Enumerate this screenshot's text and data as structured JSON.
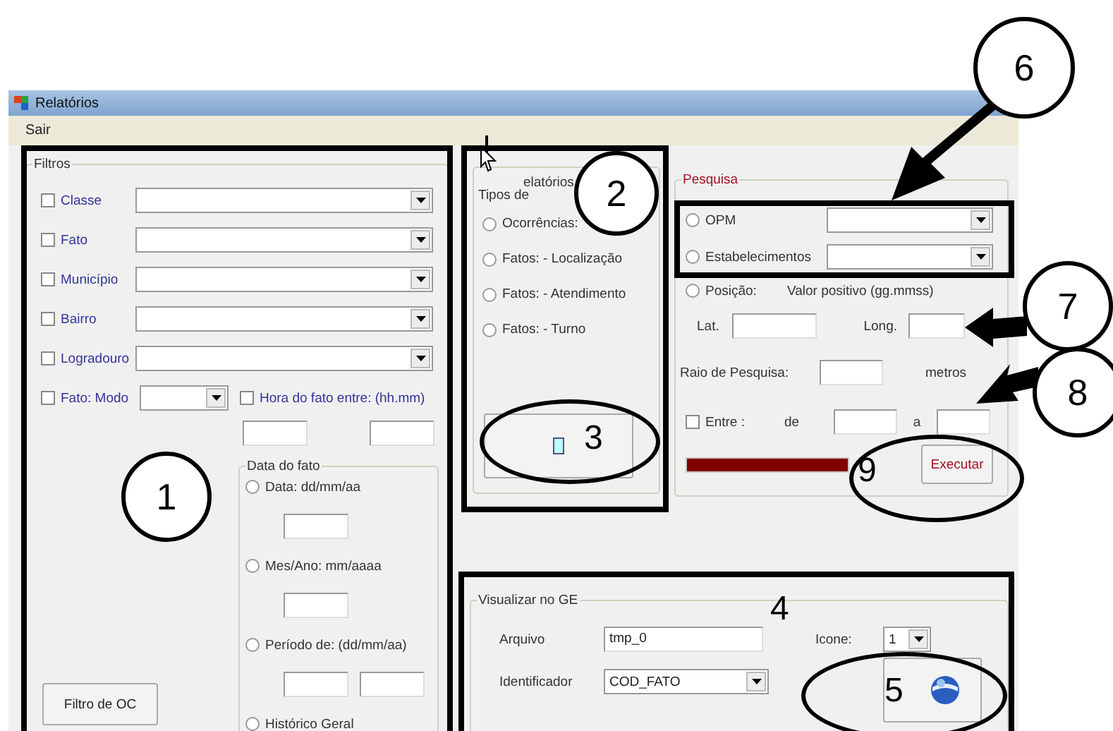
{
  "window": {
    "title": "Relatórios"
  },
  "menu": [
    "Sair"
  ],
  "filters": {
    "title": "Filtros",
    "rows": [
      {
        "label": "Classe",
        "checked": false
      },
      {
        "label": "Fato",
        "checked": false
      },
      {
        "label": "Município",
        "checked": false
      },
      {
        "label": "Bairro",
        "checked": false
      },
      {
        "label": "Logradouro",
        "checked": false
      }
    ],
    "mode": {
      "label": "Fato: Modo",
      "checked": false
    },
    "hour": {
      "label": "Hora do fato entre: (hh.mm)",
      "checked": false
    },
    "date_group": {
      "title": "Data do fato",
      "options": [
        {
          "label": "Data: dd/mm/aa",
          "selected": false,
          "kind": "single"
        },
        {
          "label": "Mes/Ano: mm/aaaa",
          "selected": false,
          "kind": "single"
        },
        {
          "label": "Período de: (dd/mm/aa)",
          "selected": false,
          "kind": "range"
        },
        {
          "label": "Histórico Geral",
          "selected": false,
          "kind": "plain"
        }
      ]
    },
    "button": "Filtro de OC"
  },
  "report_types": {
    "title": "Tipos de",
    "title_covered": "elatórios",
    "options": [
      {
        "label": "Ocorrências:",
        "selected": false
      },
      {
        "label": "Fatos: - Localização",
        "selected": false
      },
      {
        "label": "Fatos: - Atendimento",
        "selected": false
      },
      {
        "label": "Fatos: - Turno",
        "selected": false
      }
    ]
  },
  "search": {
    "title": "Pesquisa",
    "options": [
      {
        "label": "OPM",
        "selected": false
      },
      {
        "label": "Estabelecimentos",
        "selected": false
      }
    ],
    "position": {
      "label": "Posição:",
      "selected": false,
      "hint": "Valor positivo (gg.mmss)",
      "lat": "Lat.",
      "long": "Long."
    },
    "radius": {
      "label": "Raio de Pesquisa:",
      "unit": "metros"
    },
    "between": {
      "label": "Entre :",
      "checked": false,
      "from": "de",
      "to": "a"
    },
    "progress": {
      "level": 1
    },
    "button": "Executar"
  },
  "google_earth": {
    "title": "Visualizar no GE",
    "file_label": "Arquivo",
    "file": "tmp_0",
    "icon_label": "Icone:",
    "icon": "1",
    "id_label": "Identificador",
    "id": "COD_FATO"
  },
  "annotations": [
    {
      "label": "1",
      "kind": "circle"
    },
    {
      "label": "2",
      "kind": "circle"
    },
    {
      "label": "3",
      "kind": "ellipse"
    },
    {
      "label": "4",
      "kind": "plain"
    },
    {
      "label": "5",
      "kind": "ellipse"
    },
    {
      "label": "6",
      "kind": "arrow"
    },
    {
      "label": "7",
      "kind": "arrow"
    },
    {
      "label": "8",
      "kind": "arrow"
    },
    {
      "label": "9",
      "kind": "ellipse"
    }
  ]
}
